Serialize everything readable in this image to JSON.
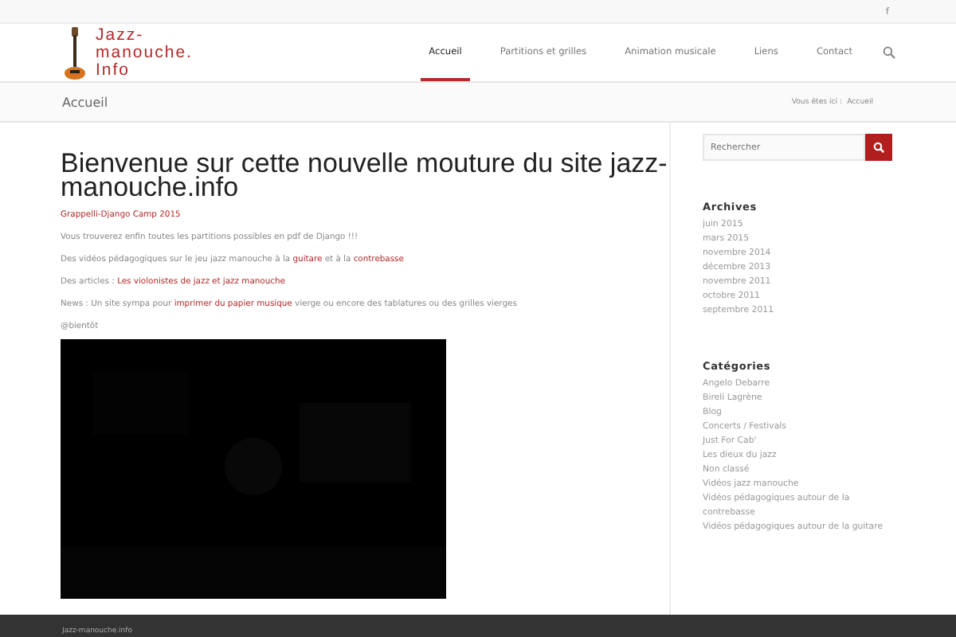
{
  "top_bar": {
    "social": "f"
  },
  "logo": {
    "lines": [
      "Jazz-",
      "manouche.",
      "Info"
    ]
  },
  "nav": [
    {
      "label": "Accueil",
      "selected": true
    },
    {
      "label": "Partitions et grilles",
      "selected": false
    },
    {
      "label": "Animation musicale",
      "selected": false
    },
    {
      "label": "Liens",
      "selected": false
    },
    {
      "label": "Contact",
      "selected": false
    }
  ],
  "page_title": "Accueil",
  "breadcrumb": {
    "prefix": "Vous êtes ici :",
    "current": "Accueil"
  },
  "article": {
    "title": "Bienvenue sur cette nouvelle mouture du site jazz-manouche.info",
    "paragraphs": [
      [
        {
          "kind": "link",
          "text": "Grappelli-Django Camp 2015"
        }
      ],
      [
        {
          "kind": "text",
          "text": "Vous trouverez enfin toutes les partitions possibles en pdf de Django !!!"
        }
      ],
      [
        {
          "kind": "text",
          "text": "Des vidéos pédagogiques sur le jeu jazz manouche à la "
        },
        {
          "kind": "link",
          "text": "guitare"
        },
        {
          "kind": "text",
          "text": " et à la "
        },
        {
          "kind": "link",
          "text": "contrebasse"
        }
      ],
      [
        {
          "kind": "text",
          "text": "Des articles  : "
        },
        {
          "kind": "link",
          "text": "Les violonistes de jazz et jazz manouche"
        }
      ],
      [
        {
          "kind": "text",
          "text": "News : Un site sympa pour "
        },
        {
          "kind": "link",
          "text": "imprimer du papier musique"
        },
        {
          "kind": "text",
          "text": " vierge ou encore des tablatures ou des grilles vierges"
        }
      ],
      [
        {
          "kind": "text",
          "text": "@bientôt"
        }
      ]
    ],
    "video": {
      "kind": "picture"
    }
  },
  "sidebar": {
    "search": {
      "placeholder": "Rechercher"
    },
    "widgets": [
      {
        "title": "Archives",
        "items": [
          "juin 2015",
          "mars 2015",
          "novembre 2014",
          "décembre 2013",
          "novembre 2011",
          "octobre 2011",
          "septembre 2011"
        ]
      },
      {
        "title": "Catégories",
        "items": [
          "Angelo Debarre",
          "Bireli Lagrène",
          "Blog",
          "Concerts / Festivals",
          "Just For Cab'",
          "Les dieux du jazz",
          "Non classé",
          "Vidéos jazz manouche",
          "Vidéos pédagogiques autour de la contrebasse",
          "Vidéos pédagogiques autour de la guitare"
        ]
      }
    ]
  },
  "footer": {
    "text": "Jazz-manouche.info"
  }
}
